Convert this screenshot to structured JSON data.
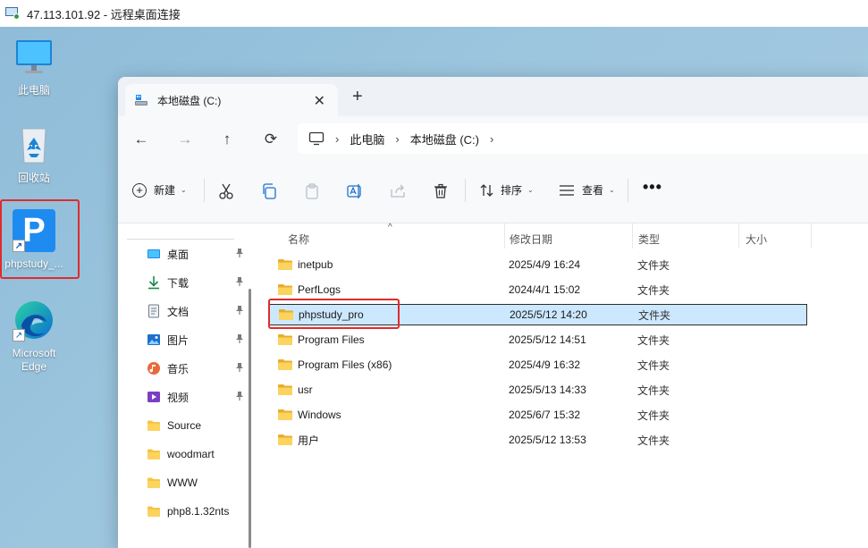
{
  "rdp": {
    "title": "47.113.101.92 - 远程桌面连接"
  },
  "desktop": {
    "icons": [
      {
        "label": "此电脑"
      },
      {
        "label": "回收站"
      },
      {
        "label": "phpstudy_..."
      },
      {
        "label": "Microsoft Edge"
      }
    ],
    "php_letter": "P"
  },
  "window": {
    "tab_label": "本地磁盘 (C:)",
    "tab_close": "✕",
    "tab_add": "+",
    "nav": {
      "back": "←",
      "forward": "→",
      "up": "↑",
      "refresh": "⟳"
    },
    "breadcrumb": [
      "此电脑",
      "本地磁盘 (C:)"
    ],
    "breadcrumb_sep": "›",
    "toolbar": {
      "new_label": "新建",
      "sort_label": "排序",
      "view_label": "查看",
      "more": "•••",
      "caret": "⌄"
    },
    "nav_pane": [
      {
        "label": "桌面",
        "icon": "desktop-icon",
        "pinned": true
      },
      {
        "label": "下载",
        "icon": "download-icon",
        "pinned": true
      },
      {
        "label": "文档",
        "icon": "document-icon",
        "pinned": true
      },
      {
        "label": "图片",
        "icon": "picture-icon",
        "pinned": true
      },
      {
        "label": "音乐",
        "icon": "music-icon",
        "pinned": true
      },
      {
        "label": "视频",
        "icon": "video-icon",
        "pinned": true
      },
      {
        "label": "Source",
        "icon": "folder-icon",
        "pinned": false
      },
      {
        "label": "woodmart",
        "icon": "folder-icon",
        "pinned": false
      },
      {
        "label": "WWW",
        "icon": "folder-icon",
        "pinned": false
      },
      {
        "label": "php8.1.32nts",
        "icon": "folder-icon",
        "pinned": false
      }
    ],
    "columns": {
      "name": "名称",
      "date": "修改日期",
      "type": "类型",
      "size": "大小"
    },
    "files": [
      {
        "name": "inetpub",
        "date": "2025/4/9 16:24",
        "type": "文件夹"
      },
      {
        "name": "PerfLogs",
        "date": "2024/4/1 15:02",
        "type": "文件夹"
      },
      {
        "name": "phpstudy_pro",
        "date": "2025/5/12 14:20",
        "type": "文件夹",
        "selected": true
      },
      {
        "name": "Program Files",
        "date": "2025/5/12 14:51",
        "type": "文件夹"
      },
      {
        "name": "Program Files (x86)",
        "date": "2025/4/9 16:32",
        "type": "文件夹"
      },
      {
        "name": "usr",
        "date": "2025/5/13 14:33",
        "type": "文件夹"
      },
      {
        "name": "Windows",
        "date": "2025/6/7 15:32",
        "type": "文件夹"
      },
      {
        "name": "用户",
        "date": "2025/5/12 13:53",
        "type": "文件夹"
      }
    ]
  },
  "colors": {
    "accent": "#1e8bf0",
    "highlight": "#e02b2b",
    "selection": "#cce8ff",
    "folder": "#f6c444"
  }
}
